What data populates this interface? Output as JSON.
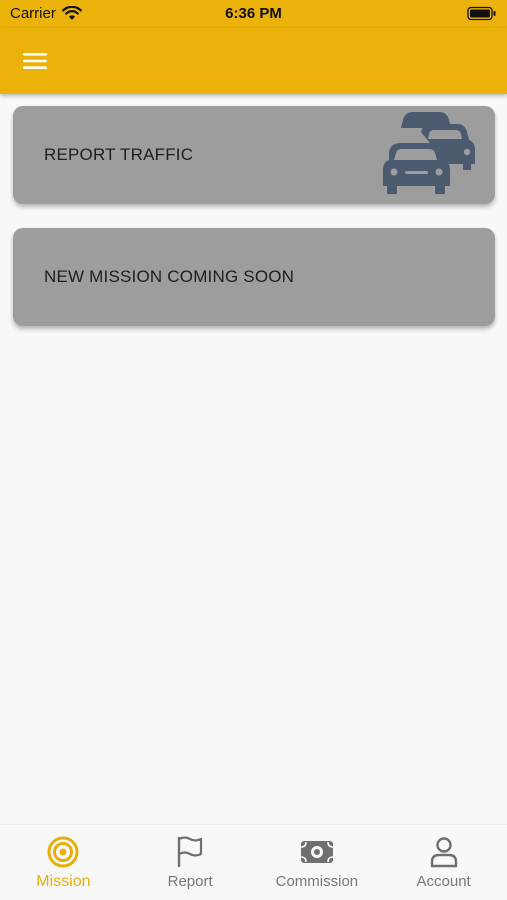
{
  "status_bar": {
    "carrier": "Carrier",
    "time": "6:36 PM"
  },
  "app_bar": {
    "menu_icon": "hamburger-menu-icon"
  },
  "missions": [
    {
      "label": "REPORT TRAFFIC",
      "icon": "traffic-cars-icon"
    },
    {
      "label": "NEW MISSION COMING SOON"
    }
  ],
  "tabs": [
    {
      "label": "Mission",
      "icon": "target-icon",
      "active": true
    },
    {
      "label": "Report",
      "icon": "flag-icon",
      "active": false
    },
    {
      "label": "Commission",
      "icon": "money-icon",
      "active": false
    },
    {
      "label": "Account",
      "icon": "person-icon",
      "active": false
    }
  ],
  "colors": {
    "accent": "#ebb20a",
    "card": "#9d9d9d",
    "icon_blue": "#4c5a70",
    "inactive": "#777777"
  }
}
